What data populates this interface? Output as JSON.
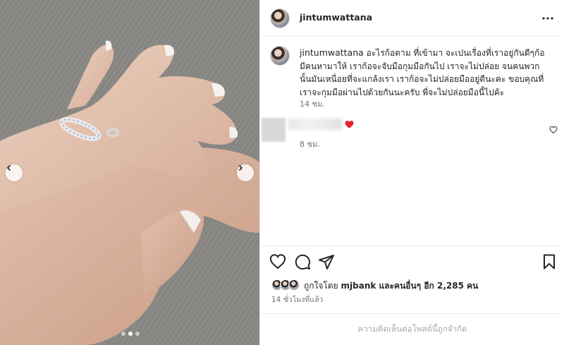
{
  "colors": {
    "accent_red": "#ed4956",
    "text": "#262626",
    "muted": "#737373",
    "border": "#efefef"
  },
  "media": {
    "carousel": {
      "count": 3,
      "active_index": 1,
      "prev_icon": "chevron-left-icon",
      "next_icon": "chevron-right-icon"
    }
  },
  "header": {
    "username": "jintumwattana",
    "more_icon": "more-horizontal-icon"
  },
  "caption": {
    "username": "jintumwattana",
    "text": "อะไรก้อตาม ที่เข้ามา จะเปนเรื่องที่เราอยู่กันดีๆก้อมีคนหามาให้ เราก้อจะจับมือกุมมือกันไป เราจะไม่ปล่อย จนคนพวกนั้นมันเหนื่อยที่จะแกล้งเรา เราก้อจะไม่ปล่อยมืออยู่ดีนะคะ ขอบคุณที่เราจะกุมมือผ่านไปด้วยกันนะครับ พี่จะไม่ปล่อยมือนี้ไปค้ะ",
    "time": "14 ชม."
  },
  "comment": {
    "emoji": "red-heart-emoji",
    "time": "8 ชม.",
    "like_icon": "heart-outline-icon"
  },
  "actions": {
    "like_icon": "heart-outline-icon",
    "comment_icon": "comment-bubble-icon",
    "share_icon": "paper-plane-icon",
    "save_icon": "bookmark-icon"
  },
  "likes": {
    "prefix": "ถูกใจโดย ",
    "first_user": "mjbank",
    "suffix": " และคนอื่นๆ อีก 2,285 คน"
  },
  "post_time": "14 ชั่วโมงที่แล้ว",
  "footer": {
    "comments_limited": "ความคิดเห็นต่อโพสต์นี้ถูกจำกัด"
  }
}
